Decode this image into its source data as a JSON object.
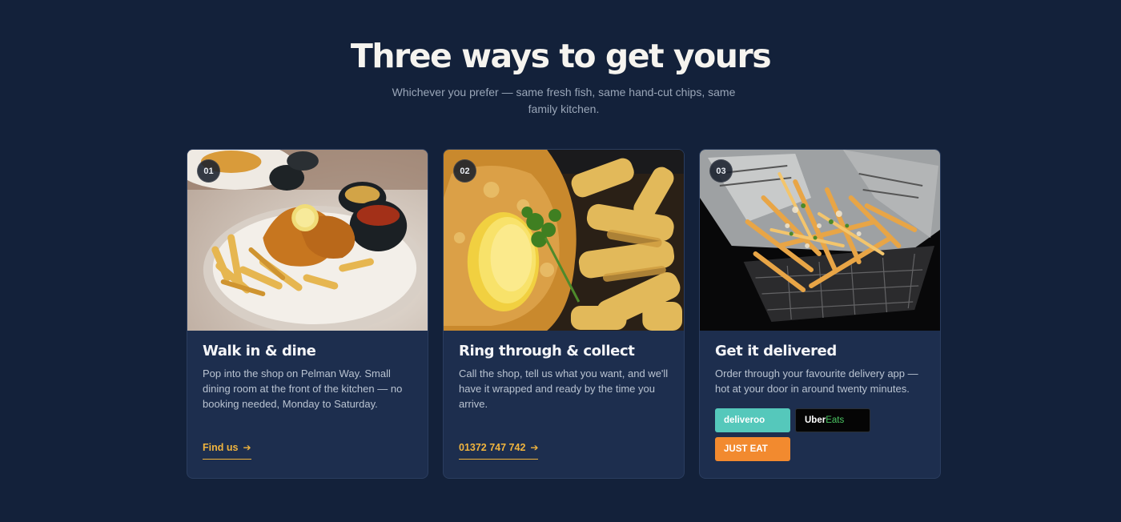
{
  "section": {
    "title": "Three ways to get yours",
    "subtitle": "Whichever you prefer — same fresh fish, same hand-cut chips, same family kitchen."
  },
  "cards": [
    {
      "number": "01",
      "title": "Walk in & dine",
      "text": "Pop into the shop on Pelman Way. Small dining room at the front of the kitchen — no booking needed, Monday to Saturday.",
      "link_label": "Find us",
      "link_icon": "arrow-right-icon",
      "image": "fish-and-chips-plate-photo"
    },
    {
      "number": "02",
      "title": "Ring through & collect",
      "text": "Call the shop, tell us what you want, and we'll have it wrapped and ready by the time you arrive.",
      "link_label": "01372 747 742",
      "link_icon": "arrow-right-icon",
      "image": "battered-fish-lemon-chips-photo"
    },
    {
      "number": "03",
      "title": "Get it delivered",
      "text": "Order through your favourite delivery app — hot at your door in around twenty minutes.",
      "image": "chips-basket-newspaper-photo",
      "apps": {
        "deliveroo": "deliveroo",
        "uber_part1": "Uber",
        "uber_part2": "Eats",
        "justeat": "JUST EAT"
      }
    }
  ],
  "colors": {
    "background": "#13213a",
    "card": "#1d2e4e",
    "accent": "#f0b43e",
    "deliveroo": "#55c8bb",
    "ubereats": "#050505",
    "justeat": "#f28a2f"
  }
}
